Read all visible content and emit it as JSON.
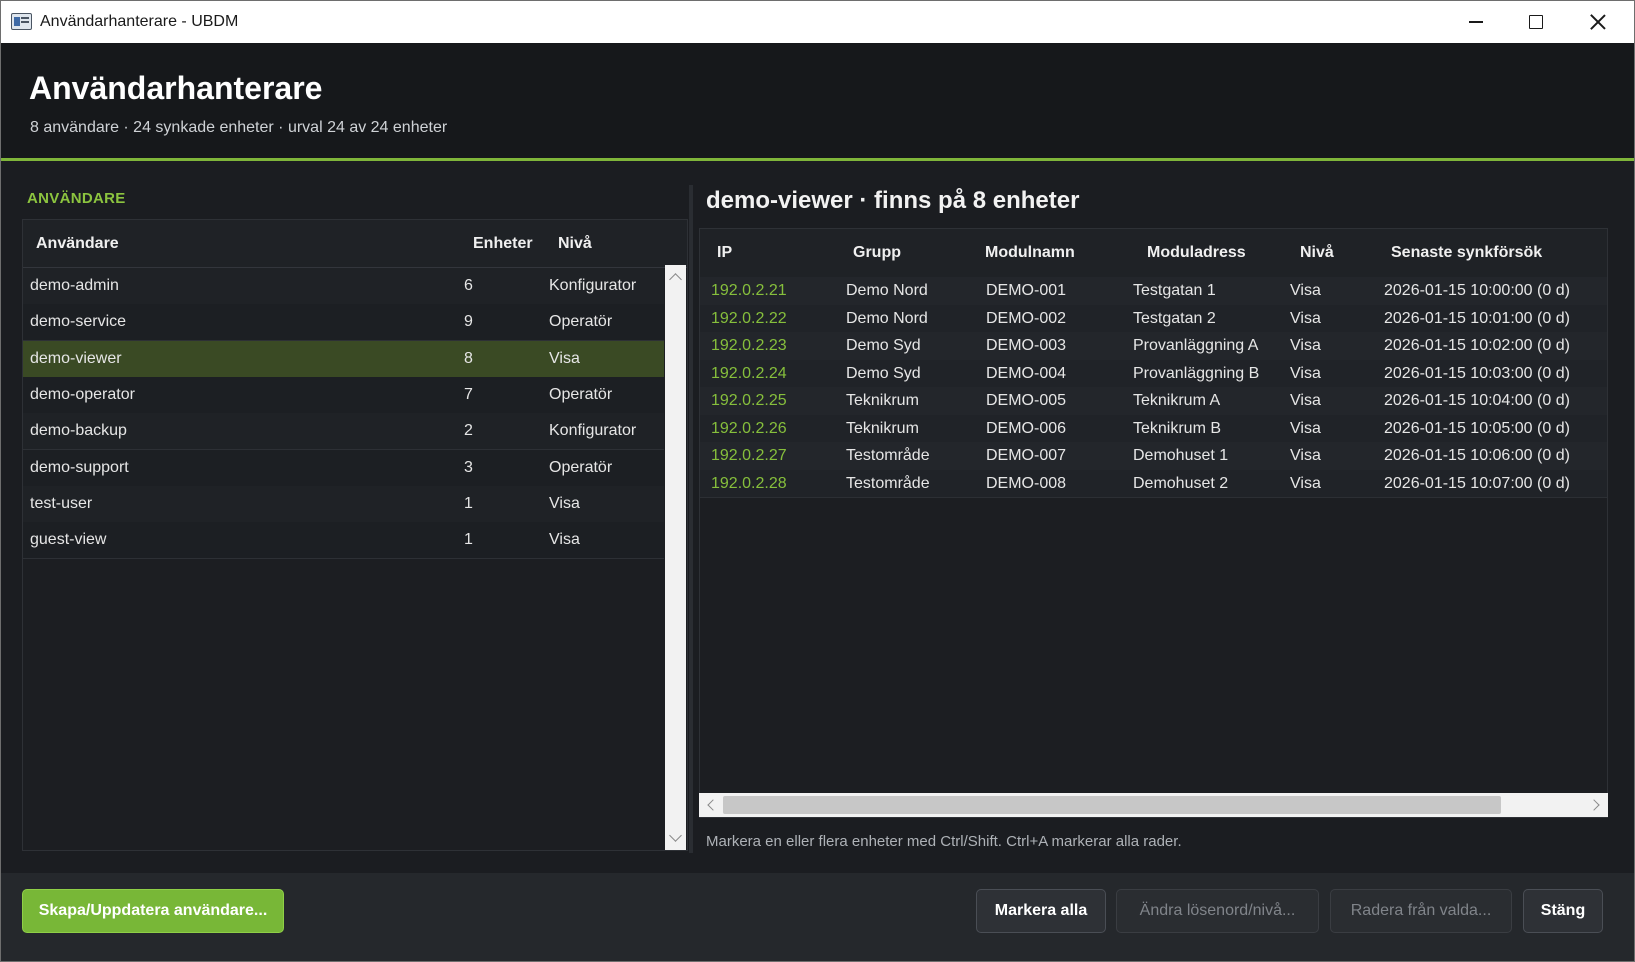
{
  "window": {
    "title": "Användarhanterare - UBDM"
  },
  "header": {
    "title": "Användarhanterare",
    "subtitle": "8 användare · 24 synkade enheter · urval 24 av 24 enheter"
  },
  "users_panel": {
    "section_label": "ANVÄNDARE",
    "columns": [
      "Användare",
      "Enheter",
      "Nivå"
    ],
    "rows": [
      {
        "user": "demo-admin",
        "devices": "6",
        "level": "Konfigurator"
      },
      {
        "user": "demo-service",
        "devices": "9",
        "level": "Operatör"
      },
      {
        "user": "demo-viewer",
        "devices": "8",
        "level": "Visa"
      },
      {
        "user": "demo-operator",
        "devices": "7",
        "level": "Operatör"
      },
      {
        "user": "demo-backup",
        "devices": "2",
        "level": "Konfigurator"
      },
      {
        "user": "demo-support",
        "devices": "3",
        "level": "Operatör"
      },
      {
        "user": "test-user",
        "devices": "1",
        "level": "Visa"
      },
      {
        "user": "guest-view",
        "devices": "1",
        "level": "Visa"
      }
    ],
    "selected_index": 2
  },
  "detail_panel": {
    "title": "demo-viewer · finns på 8 enheter",
    "columns": [
      "IP",
      "Grupp",
      "Modulnamn",
      "Moduladress",
      "Nivå",
      "Senaste synkförsök"
    ],
    "rows": [
      {
        "ip": "192.0.2.21",
        "group": "Demo Nord",
        "module": "DEMO-001",
        "address": "Testgatan 1",
        "level": "Visa",
        "last_sync": "2026-01-15 10:00:00 (0 d)"
      },
      {
        "ip": "192.0.2.22",
        "group": "Demo Nord",
        "module": "DEMO-002",
        "address": "Testgatan 2",
        "level": "Visa",
        "last_sync": "2026-01-15 10:01:00 (0 d)"
      },
      {
        "ip": "192.0.2.23",
        "group": "Demo Syd",
        "module": "DEMO-003",
        "address": "Provanläggning A",
        "level": "Visa",
        "last_sync": "2026-01-15 10:02:00 (0 d)"
      },
      {
        "ip": "192.0.2.24",
        "group": "Demo Syd",
        "module": "DEMO-004",
        "address": "Provanläggning B",
        "level": "Visa",
        "last_sync": "2026-01-15 10:03:00 (0 d)"
      },
      {
        "ip": "192.0.2.25",
        "group": "Teknikrum",
        "module": "DEMO-005",
        "address": "Teknikrum A",
        "level": "Visa",
        "last_sync": "2026-01-15 10:04:00 (0 d)"
      },
      {
        "ip": "192.0.2.26",
        "group": "Teknikrum",
        "module": "DEMO-006",
        "address": "Teknikrum B",
        "level": "Visa",
        "last_sync": "2026-01-15 10:05:00 (0 d)"
      },
      {
        "ip": "192.0.2.27",
        "group": "Testområde",
        "module": "DEMO-007",
        "address": "Demohuset 1",
        "level": "Visa",
        "last_sync": "2026-01-15 10:06:00 (0 d)"
      },
      {
        "ip": "192.0.2.28",
        "group": "Testområde",
        "module": "DEMO-008",
        "address": "Demohuset 2",
        "level": "Visa",
        "last_sync": "2026-01-15 10:07:00 (0 d)"
      }
    ],
    "hint": "Markera en eller flera enheter med Ctrl/Shift. Ctrl+A markerar alla rader."
  },
  "footer": {
    "create_update_label": "Skapa/Uppdatera användare...",
    "mark_all_label": "Markera alla",
    "change_password_label": "Ändra lösenord/nivå...",
    "delete_label": "Radera från valda...",
    "close_label": "Stäng"
  },
  "colors": {
    "accent": "#7fb53a",
    "ip_text": "#86bf3c",
    "selected_row": "#3a4a24",
    "primary_button": "#78b737"
  },
  "icons": {
    "app": "window-app-icon",
    "minimize": "minimize-icon",
    "maximize": "maximize-icon",
    "close": "close-icon"
  }
}
